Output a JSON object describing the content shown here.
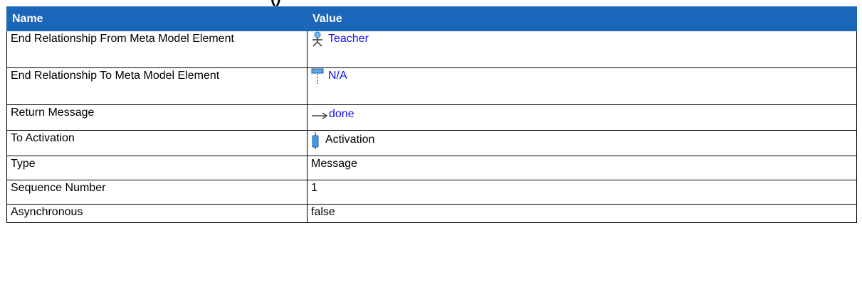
{
  "header": {
    "name_label": "Name",
    "value_label": "Value"
  },
  "rows": [
    {
      "name": "End Relationship From Meta Model Element",
      "value": "Teacher",
      "icon": "actor-icon",
      "link": true
    },
    {
      "name": "End Relationship To Meta Model Element",
      "value": "N/A",
      "icon": "lifeline-icon",
      "link": true
    },
    {
      "name": "Return Message",
      "value": "done",
      "icon": "arrow-right-icon",
      "link": true
    },
    {
      "name": "To Activation",
      "value": "Activation",
      "icon": "activation-icon",
      "link": false
    },
    {
      "name": "Type",
      "value": "Message"
    },
    {
      "name": "Sequence Number",
      "value": "1"
    },
    {
      "name": "Asynchronous",
      "value": "false"
    }
  ],
  "colors": {
    "header_bg": "#1b66b9",
    "link": "#1010f0"
  }
}
